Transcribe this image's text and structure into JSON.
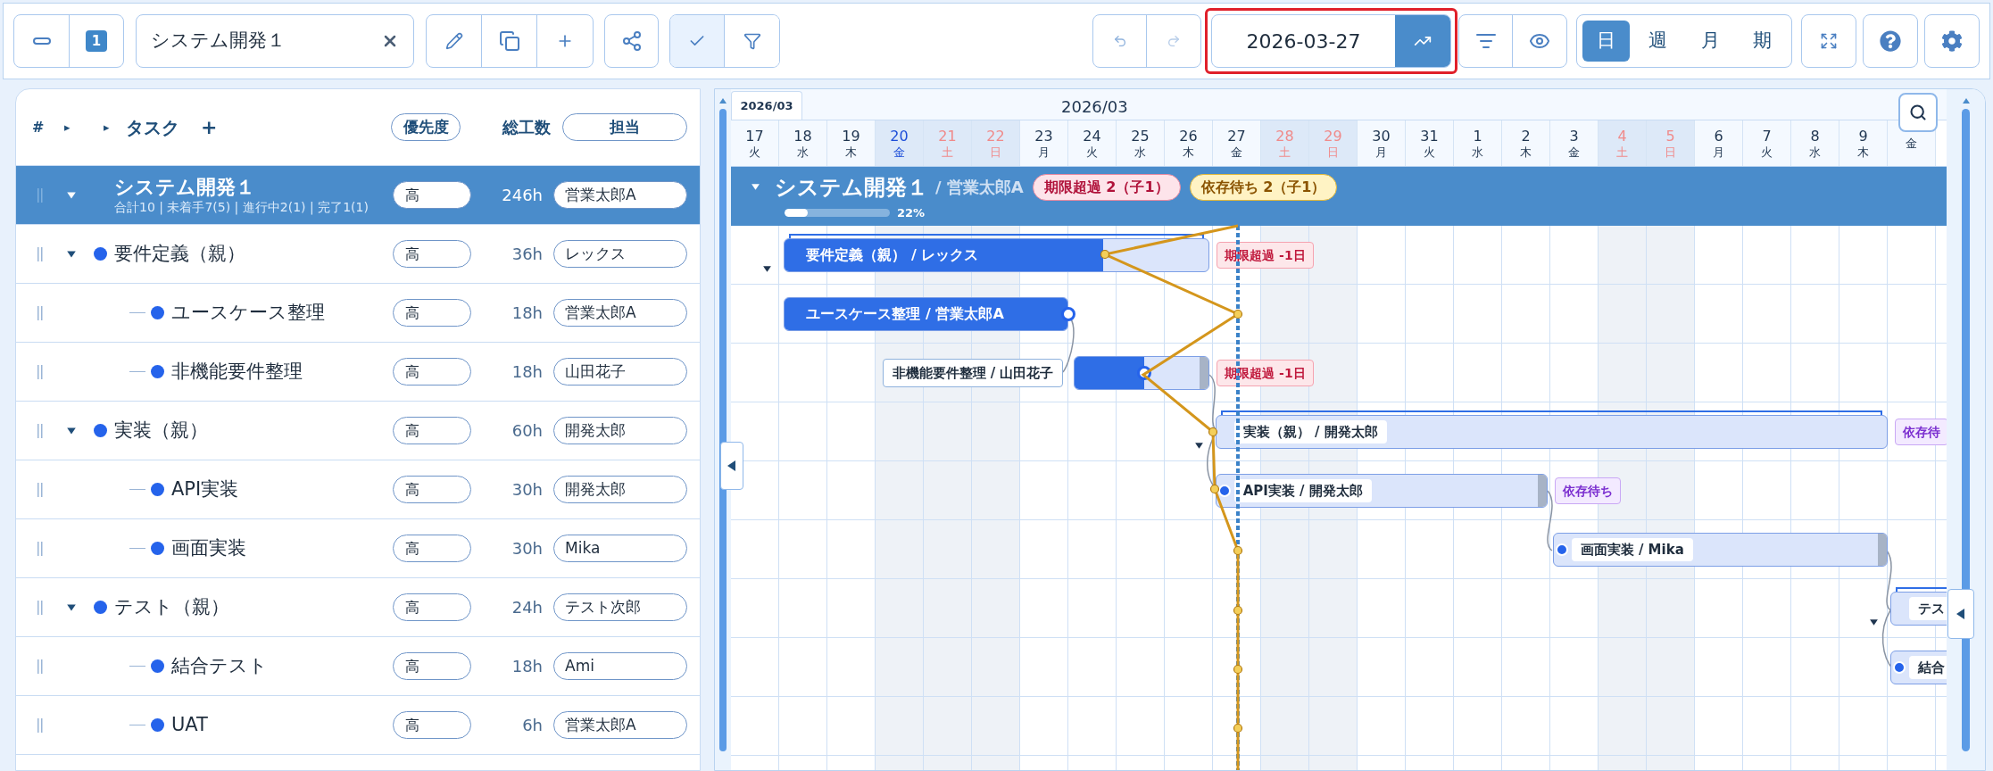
{
  "toolbar": {
    "page_badge": "1",
    "project_field": {
      "value": "システム開発１"
    },
    "toggles": [
      {
        "kind": "check",
        "selected": true
      },
      {
        "kind": "filter",
        "selected": false
      }
    ],
    "date_field": {
      "value": "2026-03-27"
    },
    "view_tabs": [
      {
        "label": "日",
        "selected": true
      },
      {
        "label": "週",
        "selected": false
      },
      {
        "label": "月",
        "selected": false
      },
      {
        "label": "期",
        "selected": false
      }
    ]
  },
  "task_table": {
    "header": {
      "number": "#",
      "expand_marks": [
        "▸",
        "▸"
      ],
      "task": "タスク",
      "add": "+",
      "priority": "優先度",
      "hours": "総工数",
      "assignee": "担当"
    },
    "rows": [
      {
        "kind": "project",
        "name": "システム開発１",
        "summary": "合計10 | 未着手7(5) | 進行中2(1) | 完了1(1)",
        "priority": "高",
        "hours": "246h",
        "assignee": "営業太郎A",
        "expanded": true,
        "children": [
          {
            "kind": "parent",
            "name": "要件定義（親）",
            "priority": "高",
            "hours": "36h",
            "assignee": "レックス",
            "expanded": true,
            "children": [
              {
                "kind": "task",
                "name": "ユースケース整理",
                "priority": "高",
                "hours": "18h",
                "assignee": "営業太郎A"
              },
              {
                "kind": "task",
                "name": "非機能要件整理",
                "priority": "高",
                "hours": "18h",
                "assignee": "山田花子"
              }
            ]
          },
          {
            "kind": "parent",
            "name": "実装（親）",
            "priority": "高",
            "hours": "60h",
            "assignee": "開発太郎",
            "expanded": true,
            "children": [
              {
                "kind": "task",
                "name": "API実装",
                "priority": "高",
                "hours": "30h",
                "assignee": "開発太郎"
              },
              {
                "kind": "task",
                "name": "画面実装",
                "priority": "高",
                "hours": "30h",
                "assignee": "Mika"
              }
            ]
          },
          {
            "kind": "parent",
            "name": "テスト（親）",
            "priority": "高",
            "hours": "24h",
            "assignee": "テスト次郎",
            "expanded": true,
            "children": [
              {
                "kind": "task",
                "name": "結合テスト",
                "priority": "高",
                "hours": "18h",
                "assignee": "Ami"
              },
              {
                "kind": "task",
                "name": "UAT",
                "priority": "高",
                "hours": "6h",
                "assignee": "営業太郎A"
              }
            ]
          }
        ]
      }
    ]
  },
  "gantt": {
    "month_tab": "2026/03",
    "month_label": "2026/03",
    "days": [
      {
        "day": "17",
        "weekday": "火",
        "kind": "weekday"
      },
      {
        "day": "18",
        "weekday": "水",
        "kind": "weekday"
      },
      {
        "day": "19",
        "weekday": "木",
        "kind": "weekday"
      },
      {
        "day": "20",
        "weekday": "金",
        "kind": "holiday"
      },
      {
        "day": "21",
        "weekday": "土",
        "kind": "weekend"
      },
      {
        "day": "22",
        "weekday": "日",
        "kind": "weekend"
      },
      {
        "day": "23",
        "weekday": "月",
        "kind": "weekday"
      },
      {
        "day": "24",
        "weekday": "火",
        "kind": "weekday"
      },
      {
        "day": "25",
        "weekday": "水",
        "kind": "weekday"
      },
      {
        "day": "26",
        "weekday": "木",
        "kind": "weekday"
      },
      {
        "day": "27",
        "weekday": "金",
        "kind": "weekday"
      },
      {
        "day": "28",
        "weekday": "土",
        "kind": "weekend"
      },
      {
        "day": "29",
        "weekday": "日",
        "kind": "weekend"
      },
      {
        "day": "30",
        "weekday": "月",
        "kind": "weekday"
      },
      {
        "day": "31",
        "weekday": "火",
        "kind": "weekday"
      },
      {
        "day": "1",
        "weekday": "水",
        "kind": "weekday"
      },
      {
        "day": "2",
        "weekday": "木",
        "kind": "weekday"
      },
      {
        "day": "3",
        "weekday": "金",
        "kind": "weekday"
      },
      {
        "day": "4",
        "weekday": "土",
        "kind": "weekend"
      },
      {
        "day": "5",
        "weekday": "日",
        "kind": "weekend"
      },
      {
        "day": "6",
        "weekday": "月",
        "kind": "weekday"
      },
      {
        "day": "7",
        "weekday": "火",
        "kind": "weekday"
      },
      {
        "day": "8",
        "weekday": "水",
        "kind": "weekday"
      },
      {
        "day": "9",
        "weekday": "木",
        "kind": "weekday"
      },
      {
        "weekday": "金",
        "kind": "weekday"
      }
    ],
    "summary": {
      "title": "システム開発１",
      "assignee": "/ 営業太郎A",
      "expanded": true,
      "level": 0.22,
      "percent": "22%",
      "badges": [
        {
          "label": "期限超過 2（子1）",
          "kind": "overdue"
        },
        {
          "label": "依存待ち 2（子1）",
          "kind": "waiting"
        }
      ]
    },
    "bars": [
      {
        "kind": "parent",
        "label": "要件定義（親） / レックス",
        "level": 0.75,
        "expanded": true,
        "badge": {
          "label": "期限超過 -1日",
          "kind": "overdue"
        }
      },
      {
        "kind": "task",
        "label": "ユースケース整理 / 営業太郎A",
        "level": 1
      },
      {
        "kind": "task",
        "label": "非機能要件整理 / 山田花子",
        "level": 0.52,
        "badge": {
          "label": "期限超過 -1日",
          "kind": "overdue"
        }
      },
      {
        "kind": "parent",
        "label": "実装（親） / 開発太郎",
        "expanded": true,
        "badge": {
          "label": "依存待",
          "kind": "waiting"
        }
      },
      {
        "kind": "task",
        "label": "API実装 / 開発太郎",
        "badge": {
          "label": "依存待ち",
          "kind": "waiting"
        }
      },
      {
        "kind": "task",
        "label": "画面実装 / Mika"
      },
      {
        "kind": "parent",
        "label": "テス",
        "expanded": true
      },
      {
        "kind": "task",
        "label": "結合"
      }
    ]
  }
}
